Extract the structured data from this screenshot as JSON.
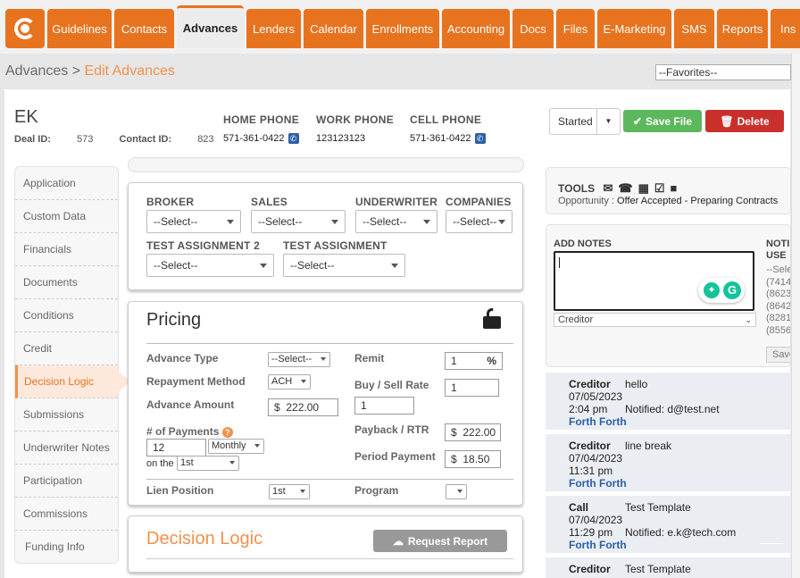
{
  "nav": {
    "tabs": [
      "Guidelines",
      "Contacts",
      "Advances",
      "Lenders",
      "Calendar",
      "Enrollments",
      "Accounting",
      "Docs",
      "Files",
      "E-Marketing",
      "SMS",
      "Reports",
      "Ins"
    ],
    "active": "Advances"
  },
  "breadcrumb": {
    "root": "Advances",
    "sep": " > ",
    "current": "Edit Advances"
  },
  "favorites": "--Favorites--",
  "deal": {
    "name": "EK",
    "deal_id_label": "Deal ID:",
    "deal_id": "573",
    "contact_id_label": "Contact ID:",
    "contact_id": "823"
  },
  "phones": {
    "home_label": "HOME PHONE",
    "home": "571-361-0422",
    "work_label": "WORK PHONE",
    "work": "123123123",
    "cell_label": "CELL PHONE",
    "cell": "571-361-0422"
  },
  "status": "Started",
  "actions": {
    "save": "Save File",
    "delete": "Delete"
  },
  "sidebar": [
    "Application",
    "Custom Data",
    "Financials",
    "Documents",
    "Conditions",
    "Credit",
    "Decision Logic",
    "Submissions",
    "Underwriter Notes",
    "Participation",
    "Commissions",
    "Funding Info"
  ],
  "sidebar_active": "Decision Logic",
  "assign": {
    "broker": "BROKER",
    "sales": "SALES",
    "underwriter": "UNDERWRITER",
    "companies": "COMPANIES",
    "test2": "TEST ASSIGNMENT 2",
    "test": "TEST ASSIGNMENT",
    "select": "--Select--"
  },
  "pricing": {
    "title": "Pricing",
    "advance_type": "Advance Type",
    "advance_type_val": "--Select--",
    "repayment": "Repayment Method",
    "repayment_val": "ACH",
    "advance_amount": "Advance Amount",
    "advance_amount_val": "222.00",
    "payments": "# of Payments",
    "payments_val": "12",
    "frequency": "Monthly",
    "on_the": "on the",
    "day": "1st",
    "lien": "Lien Position",
    "lien_val": "1st",
    "remit": "Remit",
    "remit_val": "1",
    "pct": "%",
    "buy_sell": "Buy / Sell Rate",
    "buy_val": "1",
    "buy_val2": "1",
    "payback": "Payback / RTR",
    "payback_val": "222.00",
    "period": "Period Payment",
    "period_val": "18.50",
    "program": "Program",
    "currency": "$"
  },
  "decision": {
    "title": "Decision Logic",
    "request": "Request Report"
  },
  "tools": {
    "label": "TOOLS",
    "opp_label": "Opportunity :",
    "opp_val": "Offer Accepted - Preparing Contracts"
  },
  "notes": {
    "add_label": "ADD NOTES",
    "users_label": "NOTI",
    "users_label2": "USE",
    "users": [
      "--Sele",
      "(7414",
      "(8623",
      "(8642",
      "(8281",
      "(8556"
    ],
    "type": "Creditor",
    "save": "Save"
  },
  "note_list": [
    {
      "title": "Creditor",
      "date": "07/05/2023",
      "time": "2:04 pm",
      "author": "Forth Forth",
      "msg": "hello",
      "notified": "Notified: d@test.net"
    },
    {
      "title": "Creditor",
      "date": "07/04/2023",
      "time": "11:31 pm",
      "author": "Forth Forth",
      "msg": "line break",
      "notified": ""
    },
    {
      "title": "Call",
      "date": "07/04/2023",
      "time": "11:29 pm",
      "author": "Forth Forth",
      "msg": "Test Template",
      "notified": "Notified: e.k@tech.com"
    },
    {
      "title": "Creditor",
      "date": "",
      "time": "",
      "author": "",
      "msg": "Test Template",
      "notified": ""
    }
  ]
}
